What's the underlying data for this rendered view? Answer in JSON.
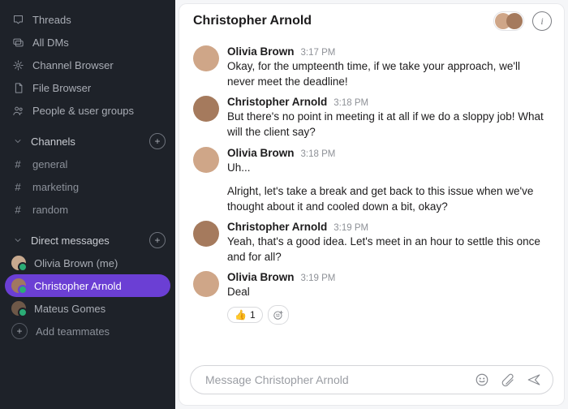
{
  "sidebar": {
    "nav": [
      {
        "label": "Threads"
      },
      {
        "label": "All DMs"
      },
      {
        "label": "Channel Browser"
      },
      {
        "label": "File Browser"
      },
      {
        "label": "People & user groups"
      }
    ],
    "channels_header": "Channels",
    "channels": [
      {
        "label": "general"
      },
      {
        "label": "marketing"
      },
      {
        "label": "random"
      }
    ],
    "dms_header": "Direct messages",
    "dms": [
      {
        "label": "Olivia Brown (me)"
      },
      {
        "label": "Christopher Arnold"
      },
      {
        "label": "Mateus Gomes"
      }
    ],
    "add_teammates": "Add teammates"
  },
  "header": {
    "title": "Christopher Arnold"
  },
  "messages": [
    {
      "author": "Olivia Brown",
      "time": "3:17 PM",
      "text": "Okay, for the umpteenth time, if we take your approach, we'll never meet the deadline!"
    },
    {
      "author": "Christopher Arnold",
      "time": "3:18 PM",
      "text": "But there's no point in meeting it at all if we do a sloppy job! What will the client say?"
    },
    {
      "author": "Olivia Brown",
      "time": "3:18 PM",
      "text": "Uh...",
      "extra": "Alright, let's take a break and get back to this issue when we've thought about it and cooled down a bit, okay?"
    },
    {
      "author": "Christopher Arnold",
      "time": "3:19 PM",
      "text": "Yeah, that's a good idea. Let's meet in an hour to settle this once and for all?"
    },
    {
      "author": "Olivia Brown",
      "time": "3:19 PM",
      "text": "Deal",
      "reaction_emoji": "👍",
      "reaction_count": "1"
    }
  ],
  "composer": {
    "placeholder": "Message Christopher Arnold"
  }
}
